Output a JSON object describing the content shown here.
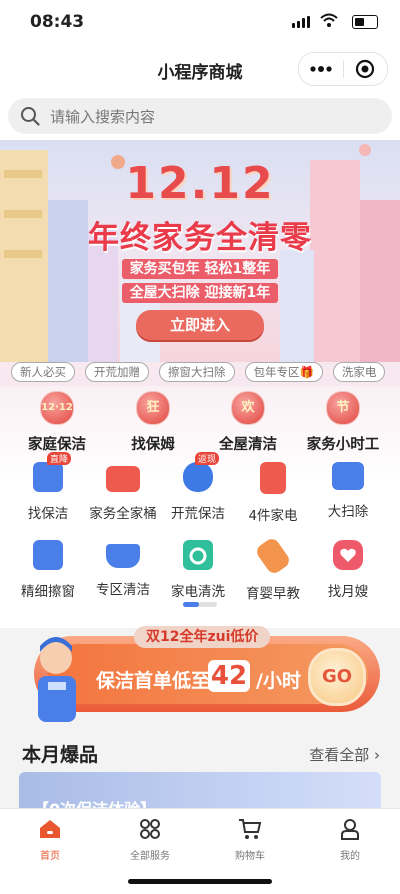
{
  "status": {
    "time": "08:43"
  },
  "nav": {
    "title": "小程序商城"
  },
  "search": {
    "placeholder": "请输入搜索内容"
  },
  "banner": {
    "title_big": "12.12",
    "title_main": "年终家务全清零",
    "line1": "家务买包年 轻松1整年",
    "line2": "全屋大扫除 迎接新1年",
    "button": "立即进入"
  },
  "tags": [
    "新人必买",
    "开荒加赠",
    "擦窗大扫除",
    "包年专区🎁",
    "洗家电"
  ],
  "categories": [
    {
      "badge": "12·12",
      "label": "家庭保洁"
    },
    {
      "badge": "狂",
      "label": "找保姆"
    },
    {
      "badge": "欢",
      "label": "全屋清洁"
    },
    {
      "badge": "节",
      "label": "家务小时工"
    }
  ],
  "services_row1": [
    {
      "label": "找保洁",
      "badge": "直降",
      "icon": "cleaning-spray-icon",
      "color": "#4a7ee8"
    },
    {
      "label": "家务全家桶",
      "badge": "",
      "icon": "house-icon",
      "color": "#ef5a4e"
    },
    {
      "label": "开荒保洁",
      "badge": "返现",
      "icon": "vacuum-icon",
      "color": "#3e7ae6"
    },
    {
      "label": "4件家电",
      "badge": "",
      "icon": "fridge-icon",
      "color": "#ef5a4e"
    },
    {
      "label": "大扫除",
      "badge": "",
      "icon": "warehouse-icon",
      "color": "#4a7ee8"
    }
  ],
  "services_row2": [
    {
      "label": "精细擦窗",
      "icon": "window-icon",
      "color": "#4a7ee8"
    },
    {
      "label": "专区清洁",
      "icon": "bathtub-icon",
      "color": "#4a7ee8"
    },
    {
      "label": "家电清洗",
      "icon": "washer-icon",
      "color": "#2fbf9b"
    },
    {
      "label": "育婴早教",
      "icon": "baby-bottle-icon",
      "color": "#f2944b"
    },
    {
      "label": "找月嫂",
      "icon": "heart-icon",
      "color": "#ef5a6a"
    }
  ],
  "promo": {
    "tagline": "双12全年zui低价",
    "text_before": "保洁首单低至",
    "number": "42",
    "text_after": "/小时",
    "go": "GO"
  },
  "section": {
    "title": "本月爆品",
    "more": "查看全部 ›"
  },
  "card": {
    "text": "【0次保洁体验】"
  },
  "tabbar": [
    {
      "label": "首页",
      "icon": "home-icon",
      "active": true
    },
    {
      "label": "全部服务",
      "icon": "grid-icon",
      "active": false
    },
    {
      "label": "购物车",
      "icon": "cart-icon",
      "active": false
    },
    {
      "label": "我的",
      "icon": "user-icon",
      "active": false
    }
  ],
  "colors": {
    "accent": "#e8572f",
    "brand_blue": "#4a7ee8",
    "promo_orange": "#ea5b3a"
  }
}
